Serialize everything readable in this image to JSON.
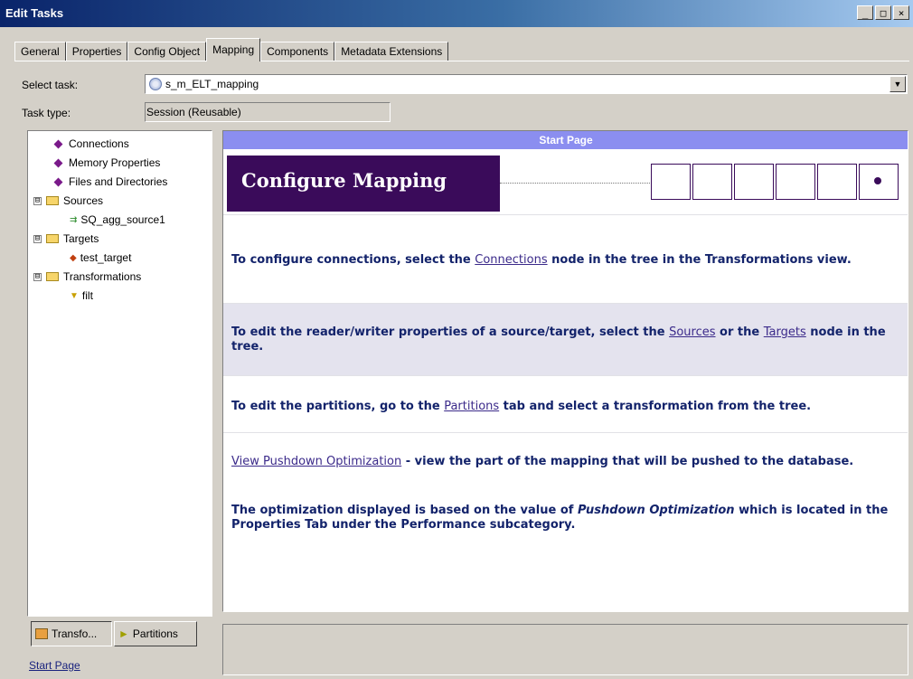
{
  "window": {
    "title": "Edit Tasks",
    "controls": [
      "_",
      "□",
      "×"
    ]
  },
  "tabs": [
    {
      "label": "General"
    },
    {
      "label": "Properties"
    },
    {
      "label": "Config Object"
    },
    {
      "label": "Mapping"
    },
    {
      "label": "Components"
    },
    {
      "label": "Metadata Extensions"
    }
  ],
  "active_tab": "Mapping",
  "form": {
    "select_task_label": "Select task:",
    "select_task_value": "s_m_ELT_mapping",
    "task_type_label": "Task type:",
    "task_type_value": "Session (Reusable)"
  },
  "tree": {
    "connections": "Connections",
    "memory": "Memory Properties",
    "files": "Files and Directories",
    "sources": "Sources",
    "source_item": "SQ_agg_source1",
    "targets": "Targets",
    "target_item": "test_target",
    "transformations": "Transformations",
    "transformation_item": "filt",
    "expander": "⊟"
  },
  "bottom_tabs": {
    "transformations": "Transfo...",
    "partitions": "Partitions"
  },
  "start_page_link": "Start Page",
  "right": {
    "header": "Start Page",
    "banner_title": "Configure Mapping",
    "s1_pre": "To configure connections, select the ",
    "s1_link": "Connections",
    "s1_post": " node in the tree in the Transformations view.",
    "s2_pre": "To edit the reader/writer properties of a source/target, select the ",
    "s2_link1": "Sources",
    "s2_mid": " or the ",
    "s2_link2": "Targets",
    "s2_post": " node in the tree.",
    "s3_pre": "To edit the partitions, go to the ",
    "s3_link": "Partitions",
    "s3_post": " tab and select a transformation from the tree.",
    "s4_link": "View Pushdown Optimization",
    "s4_post": " - view the part of the mapping that will be pushed to the database.",
    "s5_pre": "The optimization displayed is based on the value of ",
    "s5_em": "Pushdown Optimization",
    "s5_post": " which is located in the Properties Tab under the Performance subcategory."
  },
  "colors": {
    "accent": "#3a0b5a",
    "header": "#8b8ef0",
    "text": "#13236b"
  }
}
